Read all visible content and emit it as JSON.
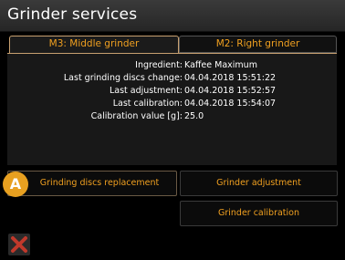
{
  "header": {
    "title": "Grinder services"
  },
  "tabs": [
    {
      "label": "M3: Middle grinder",
      "active": true
    },
    {
      "label": "M2: Right grinder",
      "active": false
    }
  ],
  "info": [
    {
      "label": "Ingredient:",
      "value": "Kaffee Maximum"
    },
    {
      "label": "Last grinding discs change:",
      "value": "04.04.2018 15:51:22"
    },
    {
      "label": "Last adjustment:",
      "value": "04.04.2018 15:52:57"
    },
    {
      "label": "Last calibration:",
      "value": "04.04.2018 15:54:07"
    },
    {
      "label": "Calibration value [g]:",
      "value": "25.0"
    }
  ],
  "buttons": {
    "replace": "Grinding discs replacement",
    "adjust": "Grinder adjustment",
    "calibrate": "Grinder calibration"
  },
  "badge": {
    "text": "A"
  },
  "colors": {
    "accent": "#f0a020",
    "close_icon": "#c0392b",
    "badge": "#e8a020"
  },
  "icons": {
    "close": "close-x-icon"
  }
}
